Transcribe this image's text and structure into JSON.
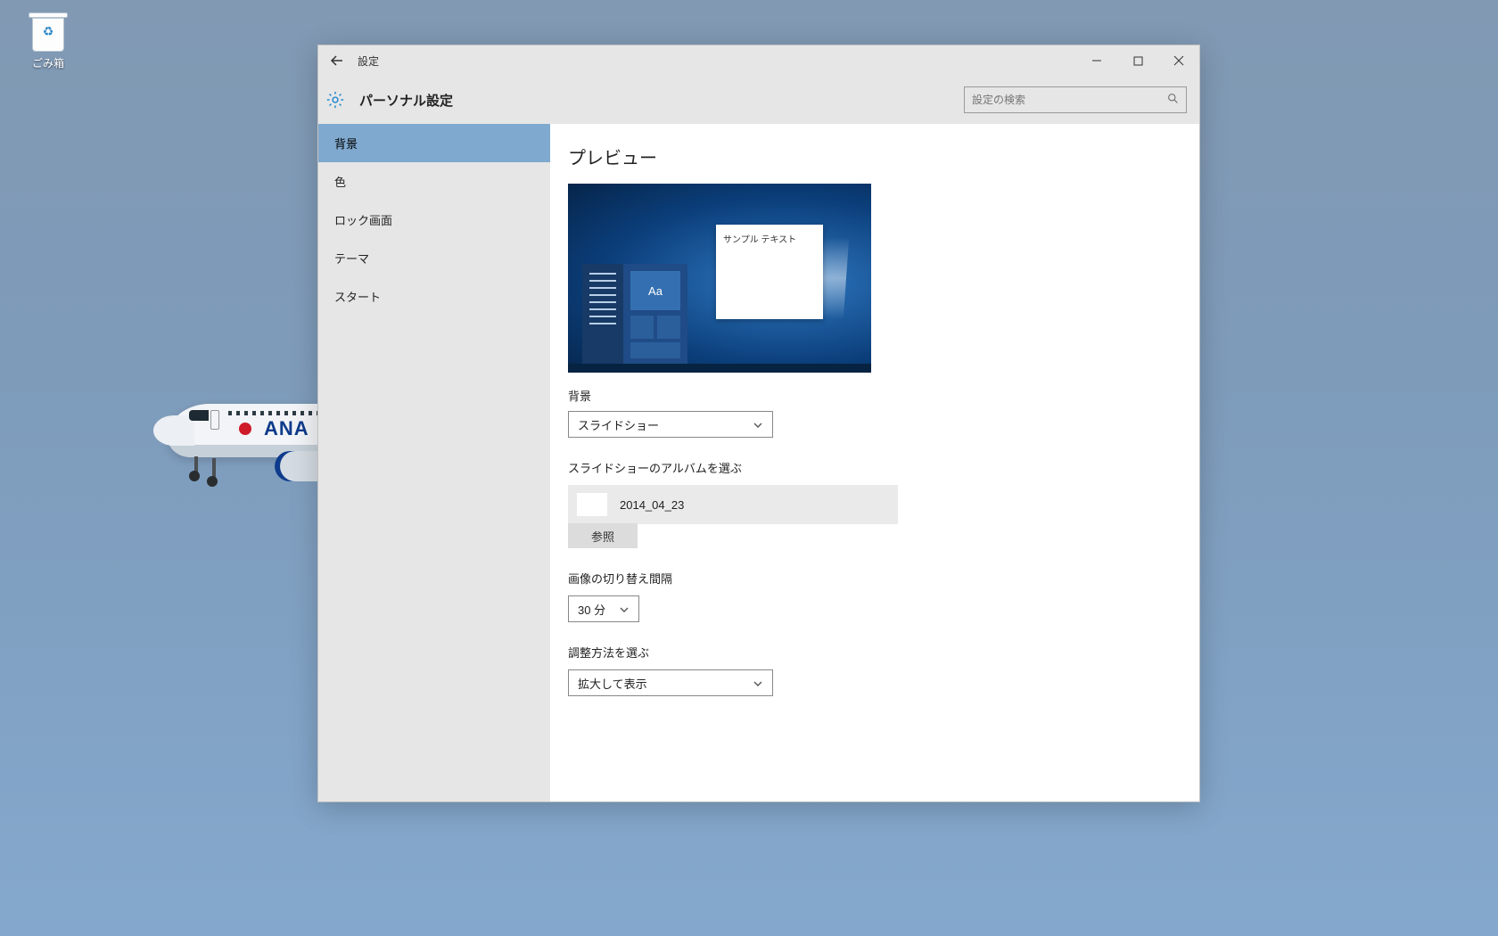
{
  "desktop": {
    "recycle_bin_label": "ごみ箱",
    "airplane_logo": "ANA"
  },
  "window": {
    "title": "設定",
    "page_title": "パーソナル設定",
    "search_placeholder": "設定の検索"
  },
  "sidebar": {
    "items": [
      {
        "label": "背景",
        "active": true
      },
      {
        "label": "色"
      },
      {
        "label": "ロック画面"
      },
      {
        "label": "テーマ"
      },
      {
        "label": "スタート"
      }
    ]
  },
  "content": {
    "preview_heading": "プレビュー",
    "preview_sample_text": "サンプル テキスト",
    "preview_tile_text": "Aa",
    "background_label": "背景",
    "background_value": "スライドショー",
    "album_label": "スライドショーのアルバムを選ぶ",
    "album_value": "2014_04_23",
    "browse_label": "参照",
    "interval_label": "画像の切り替え間隔",
    "interval_value": "30 分",
    "fit_label": "調整方法を選ぶ",
    "fit_value": "拡大して表示"
  }
}
